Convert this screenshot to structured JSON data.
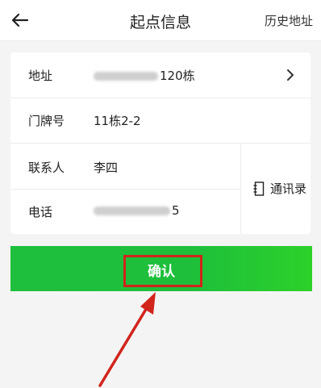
{
  "header": {
    "title": "起点信息",
    "history_label": "历史地址"
  },
  "form": {
    "address": {
      "label": "地址",
      "value_visible": "120栋"
    },
    "door": {
      "label": "门牌号",
      "value": "11栋2-2"
    },
    "contact": {
      "label": "联系人",
      "value": "李四"
    },
    "phone": {
      "label": "电话",
      "value_visible": "5"
    },
    "address_book_label": "通讯录"
  },
  "confirm": {
    "label": "确认"
  },
  "colors": {
    "brand_green": "#1ebf3b",
    "annotation_red": "#d1241b"
  }
}
